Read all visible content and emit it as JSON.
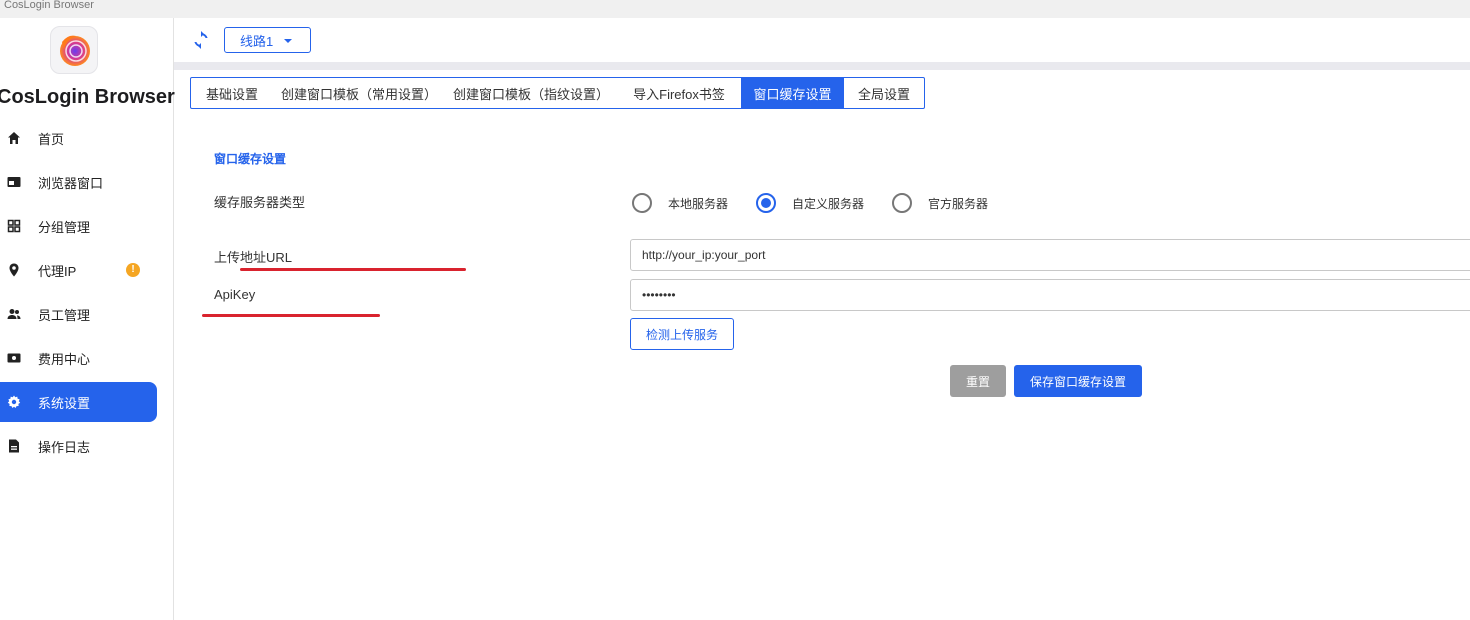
{
  "window": {
    "title": "CosLogin Browser"
  },
  "brand": {
    "name": "CosLogin Browser"
  },
  "sidebar": {
    "items": [
      {
        "label": "首页",
        "icon": "home-icon"
      },
      {
        "label": "浏览器窗口",
        "icon": "browser-window-icon"
      },
      {
        "label": "分组管理",
        "icon": "grid-icon"
      },
      {
        "label": "代理IP",
        "icon": "location-pin-icon",
        "badge": "!"
      },
      {
        "label": "员工管理",
        "icon": "people-icon"
      },
      {
        "label": "费用中心",
        "icon": "billing-icon"
      },
      {
        "label": "系统设置",
        "icon": "gear-icon",
        "active": true
      },
      {
        "label": "操作日志",
        "icon": "document-icon"
      }
    ]
  },
  "topbar": {
    "line_select": "线路1",
    "refresh_icon": "refresh-icon"
  },
  "tabs": [
    {
      "label": "基础设置"
    },
    {
      "label": "创建窗口模板（常用设置）"
    },
    {
      "label": "创建窗口模板（指纹设置）"
    },
    {
      "label": "导入Firefox书签"
    },
    {
      "label": "窗口缓存设置",
      "active": true
    },
    {
      "label": "全局设置"
    }
  ],
  "form": {
    "section_title": "窗口缓存设置",
    "server_type_label": "缓存服务器类型",
    "server_options": [
      {
        "label": "本地服务器",
        "checked": false
      },
      {
        "label": "自定义服务器",
        "checked": true
      },
      {
        "label": "官方服务器",
        "checked": false
      }
    ],
    "upload_url_label": "上传地址URL",
    "upload_url_value": "http://your_ip:your_port",
    "apikey_label": "ApiKey",
    "apikey_value": "••••••••",
    "check_button": "检测上传服务",
    "reset_button": "重置",
    "save_button": "保存窗口缓存设置"
  },
  "colors": {
    "accent": "#2563eb",
    "annotation": "#d9232e",
    "warning": "#f5a623"
  }
}
